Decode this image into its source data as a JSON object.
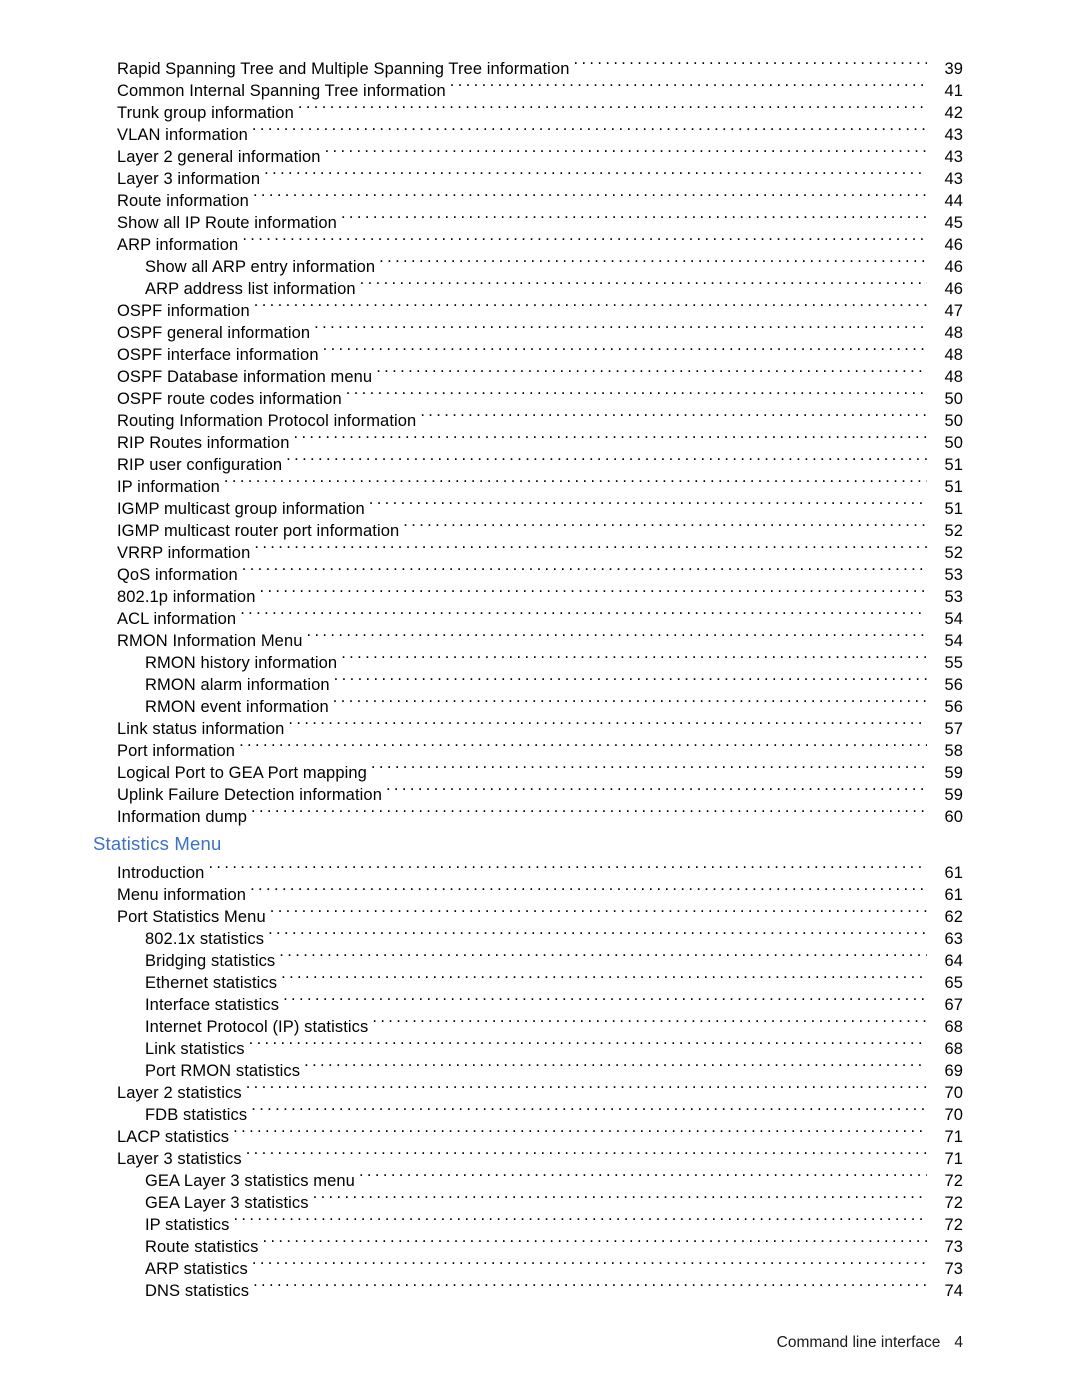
{
  "document": {
    "footer": {
      "label": "Command line interface",
      "page_number": "4"
    },
    "accent_color": "#3B6FD4"
  },
  "toc": {
    "blocks": [
      {
        "type": "entries",
        "entries": [
          {
            "level": 1,
            "title": "Rapid Spanning Tree and Multiple Spanning Tree information",
            "page": "39"
          },
          {
            "level": 1,
            "title": "Common Internal Spanning Tree information",
            "page": "41"
          },
          {
            "level": 1,
            "title": "Trunk group information",
            "page": "42"
          },
          {
            "level": 1,
            "title": "VLAN information",
            "page": "43"
          },
          {
            "level": 1,
            "title": "Layer 2 general information",
            "page": "43"
          },
          {
            "level": 1,
            "title": "Layer 3 information",
            "page": "43"
          },
          {
            "level": 1,
            "title": "Route information",
            "page": "44"
          },
          {
            "level": 1,
            "title": "Show all IP Route information",
            "page": "45"
          },
          {
            "level": 1,
            "title": "ARP information",
            "page": "46"
          },
          {
            "level": 2,
            "title": "Show all ARP entry information",
            "page": "46"
          },
          {
            "level": 2,
            "title": "ARP address list information",
            "page": "46"
          },
          {
            "level": 1,
            "title": "OSPF information",
            "page": "47"
          },
          {
            "level": 1,
            "title": "OSPF general information",
            "page": "48"
          },
          {
            "level": 1,
            "title": "OSPF interface information",
            "page": "48"
          },
          {
            "level": 1,
            "title": "OSPF Database information menu",
            "page": "48"
          },
          {
            "level": 1,
            "title": "OSPF route codes information",
            "page": "50"
          },
          {
            "level": 1,
            "title": "Routing Information Protocol information",
            "page": "50"
          },
          {
            "level": 1,
            "title": "RIP Routes information",
            "page": "50"
          },
          {
            "level": 1,
            "title": "RIP user configuration",
            "page": "51"
          },
          {
            "level": 1,
            "title": "IP information",
            "page": "51"
          },
          {
            "level": 1,
            "title": "IGMP multicast group information",
            "page": "51"
          },
          {
            "level": 1,
            "title": "IGMP multicast router port information",
            "page": "52"
          },
          {
            "level": 1,
            "title": "VRRP information",
            "page": "52"
          },
          {
            "level": 1,
            "title": "QoS information",
            "page": "53"
          },
          {
            "level": 1,
            "title": "802.1p information",
            "page": "53"
          },
          {
            "level": 1,
            "title": "ACL information",
            "page": "54"
          },
          {
            "level": 1,
            "title": "RMON Information Menu",
            "page": "54"
          },
          {
            "level": 2,
            "title": "RMON history information",
            "page": "55"
          },
          {
            "level": 2,
            "title": "RMON alarm information",
            "page": "56"
          },
          {
            "level": 2,
            "title": "RMON event information",
            "page": "56"
          },
          {
            "level": 1,
            "title": "Link status information",
            "page": "57"
          },
          {
            "level": 1,
            "title": "Port information",
            "page": "58"
          },
          {
            "level": 1,
            "title": "Logical Port to GEA Port mapping",
            "page": "59"
          },
          {
            "level": 1,
            "title": "Uplink Failure Detection information",
            "page": "59"
          },
          {
            "level": 1,
            "title": "Information dump",
            "page": "60"
          }
        ]
      },
      {
        "type": "heading",
        "title": "Statistics Menu"
      },
      {
        "type": "entries",
        "entries": [
          {
            "level": 1,
            "title": "Introduction",
            "page": "61"
          },
          {
            "level": 1,
            "title": "Menu information",
            "page": "61"
          },
          {
            "level": 1,
            "title": "Port Statistics Menu",
            "page": "62"
          },
          {
            "level": 2,
            "title": "802.1x statistics",
            "page": "63"
          },
          {
            "level": 2,
            "title": "Bridging statistics",
            "page": "64"
          },
          {
            "level": 2,
            "title": "Ethernet statistics",
            "page": "65"
          },
          {
            "level": 2,
            "title": "Interface statistics",
            "page": "67"
          },
          {
            "level": 2,
            "title": "Internet Protocol (IP) statistics",
            "page": "68"
          },
          {
            "level": 2,
            "title": "Link statistics",
            "page": "68"
          },
          {
            "level": 2,
            "title": "Port RMON statistics",
            "page": "69"
          },
          {
            "level": 1,
            "title": "Layer 2 statistics",
            "page": "70"
          },
          {
            "level": 2,
            "title": "FDB statistics",
            "page": "70"
          },
          {
            "level": 1,
            "title": "LACP statistics",
            "page": "71"
          },
          {
            "level": 1,
            "title": "Layer 3 statistics",
            "page": "71"
          },
          {
            "level": 2,
            "title": "GEA Layer 3 statistics menu",
            "page": "72"
          },
          {
            "level": 2,
            "title": "GEA Layer 3 statistics",
            "page": "72"
          },
          {
            "level": 2,
            "title": "IP statistics",
            "page": "72"
          },
          {
            "level": 2,
            "title": "Route statistics",
            "page": "73"
          },
          {
            "level": 2,
            "title": "ARP statistics",
            "page": "73"
          },
          {
            "level": 2,
            "title": "DNS statistics",
            "page": "74"
          }
        ]
      }
    ]
  }
}
